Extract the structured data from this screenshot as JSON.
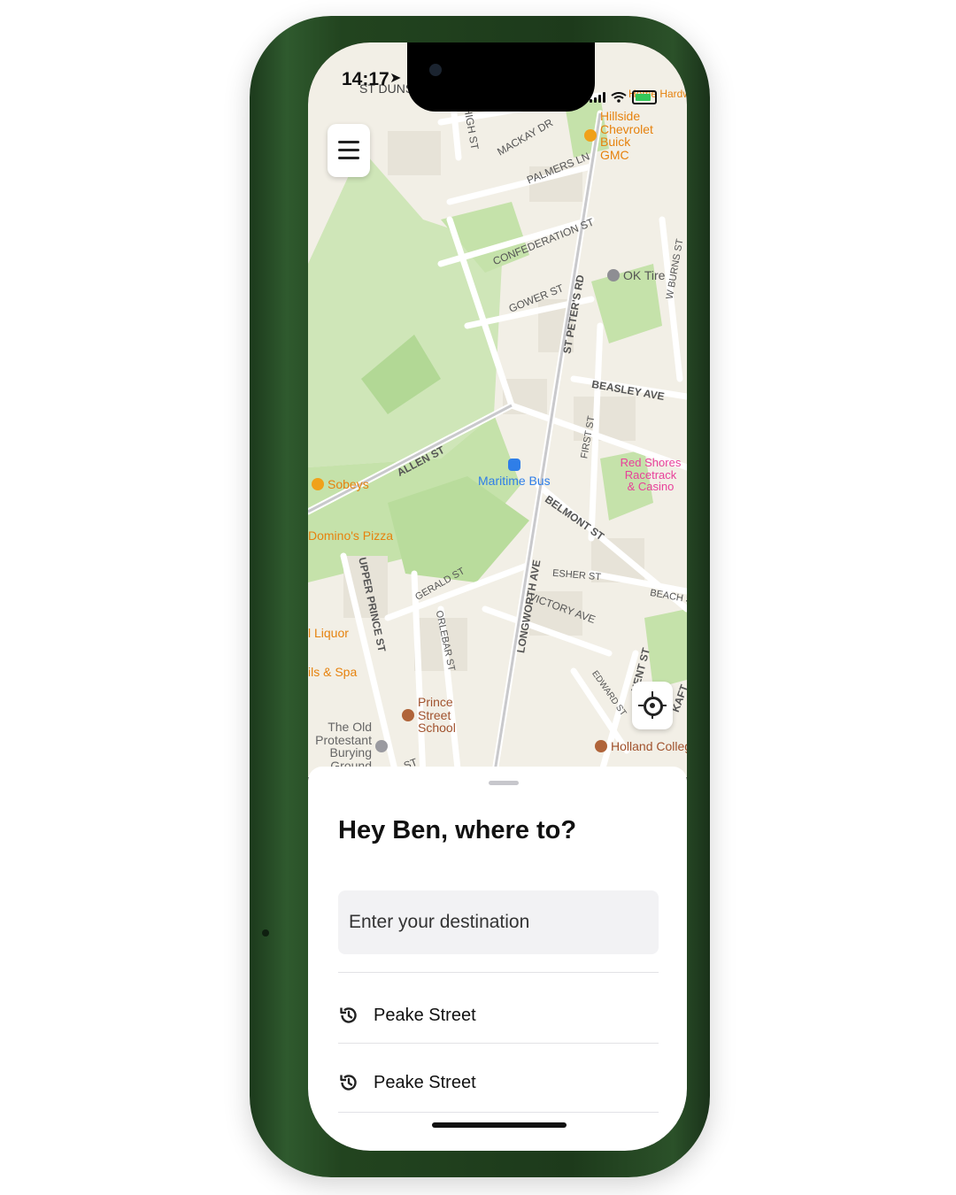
{
  "status_bar": {
    "time": "14:17",
    "location_arrow": "location-arrow-icon",
    "battery_color": "#35c759"
  },
  "map": {
    "streets": [
      "HIGH ST",
      "MACKAY DR",
      "PALMERS LN",
      "CONFEDERATION ST",
      "GOWER ST",
      "ST PETER'S RD",
      "W BURNS ST",
      "BEASLEY AVE",
      "ALLEN ST",
      "FIRST ST",
      "BELMONT ST",
      "ESHER ST",
      "LONGWORTH AVE",
      "UPPER PRINCE ST",
      "GERALD ST",
      "ORLEBAR ST",
      "VICTORY AVE",
      "BEACH S",
      "EDWARD ST",
      "KENT ST",
      "KAFT",
      "ST",
      "ST DUNSTAN'S"
    ],
    "pois": [
      {
        "label": "Hillside Chevrolet Buick GMC",
        "color": "#e6820e"
      },
      {
        "label": "Home Hardw",
        "color": "#e6820e"
      },
      {
        "label": "OK Tire",
        "color": "#7b7b80"
      },
      {
        "label": "Red Shores Racetrack & Casino",
        "color": "#e8409a"
      },
      {
        "label": "Maritime Bus",
        "color": "#2f7ee8"
      },
      {
        "label": "Sobeys",
        "color": "#f0a11a"
      },
      {
        "label": "Domino's Pizza",
        "color": "#e6820e"
      },
      {
        "label": "l Liquor",
        "color": "#e6820e"
      },
      {
        "label": "ils & Spa",
        "color": "#e6820e"
      },
      {
        "label": "Prince Street School",
        "color": "#a0522d"
      },
      {
        "label": "The Old Protestant Burying Ground",
        "color": "#7b7b80"
      },
      {
        "label": "Holland College",
        "color": "#a0522d"
      }
    ]
  },
  "controls": {
    "menu_icon": "hamburger-menu-icon",
    "locate_icon": "locate-me-icon"
  },
  "sheet": {
    "greeting": "Hey Ben, where to?",
    "destination_placeholder": "Enter your destination",
    "recent": [
      {
        "label": "Peake Street",
        "icon": "history-icon"
      },
      {
        "label": "Peake Street",
        "icon": "history-icon"
      }
    ]
  },
  "colors": {
    "phone_frame": "#23451f",
    "map_background": "#f2efe6",
    "park_green": "#c9e4b0",
    "input_background": "#f2f2f4"
  }
}
